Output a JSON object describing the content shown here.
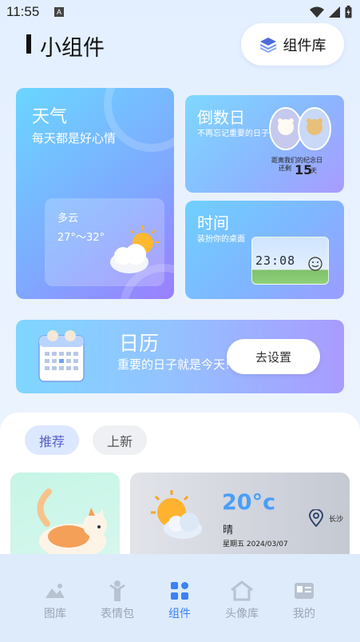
{
  "status": {
    "time": "11:55",
    "notif_icon": "A"
  },
  "header": {
    "title": "小组件",
    "library_button": "组件库"
  },
  "widgets": {
    "weather": {
      "title": "天气",
      "subtitle": "每天都是好心情",
      "condition": "多云",
      "temp_range": "27°～32°"
    },
    "countdown": {
      "title": "倒数日",
      "subtitle": "不再忘记重要的日子",
      "badge_line": "距离我们的纪念日",
      "remain_label": "还剩",
      "days": "15",
      "unit": "天"
    },
    "time": {
      "title": "时间",
      "subtitle": "装扮你的桌面",
      "clock": "23:08"
    },
    "calendar": {
      "title": "日历",
      "subtitle": "重要的日子就是今天!",
      "button": "去设置"
    }
  },
  "chips": {
    "recommend": "推荐",
    "new": "上新"
  },
  "recommend_weather": {
    "temp": "20°c",
    "condition": "晴",
    "date": "星期五 2024/03/07",
    "city": "长沙"
  },
  "tabs": [
    {
      "label": "图库",
      "icon": "gallery-icon"
    },
    {
      "label": "表情包",
      "icon": "sticker-icon"
    },
    {
      "label": "组件",
      "icon": "widgets-icon"
    },
    {
      "label": "头像库",
      "icon": "avatar-home-icon"
    },
    {
      "label": "我的",
      "icon": "profile-card-icon"
    }
  ],
  "colors": {
    "accent": "#3b82f6",
    "chip_active_text": "#5960c9",
    "tab_inactive": "#9aa4b3"
  }
}
